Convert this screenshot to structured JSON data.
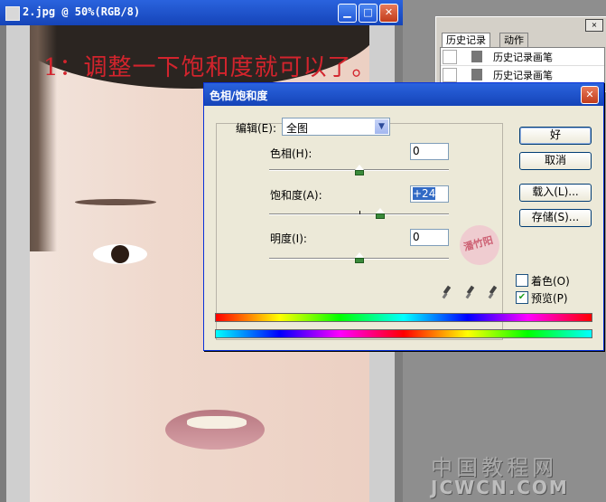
{
  "document": {
    "title": "2.jpg @ 50%(RGB/8)",
    "headline": "1：调整一下饱和度就可以了。"
  },
  "history_panel": {
    "tabs": [
      {
        "label": "历史记录"
      },
      {
        "label": "动作"
      }
    ],
    "close_label": "×",
    "items": [
      {
        "label": "历史记录画笔"
      },
      {
        "label": "历史记录画笔"
      }
    ]
  },
  "dialog": {
    "title": "色相/饱和度",
    "edit_label": "编辑(E):",
    "edit_value": "全图",
    "hue_label": "色相(H):",
    "hue_value": "0",
    "saturation_label": "饱和度(A):",
    "saturation_value": "+24",
    "lightness_label": "明度(I):",
    "lightness_value": "0",
    "buttons": {
      "ok": "好",
      "cancel": "取消",
      "load": "载入(L)...",
      "save": "存储(S)..."
    },
    "colorize_label": "着色(O)",
    "colorize_checked": false,
    "preview_label": "预览(P)",
    "preview_checked": true,
    "stamp_text": "潘竹阳"
  },
  "sliders": {
    "hue": {
      "min": -180,
      "max": 180,
      "value": 0
    },
    "saturation": {
      "min": -100,
      "max": 100,
      "value": 24
    },
    "lightness": {
      "min": -100,
      "max": 100,
      "value": 0
    }
  },
  "watermark": {
    "line1": "中国教程网",
    "line2": "JCWCN.COM"
  },
  "colors": {
    "titlebar": "#1f56c9",
    "headline": "#d3242d",
    "dialog_bg": "#ece9d8"
  }
}
